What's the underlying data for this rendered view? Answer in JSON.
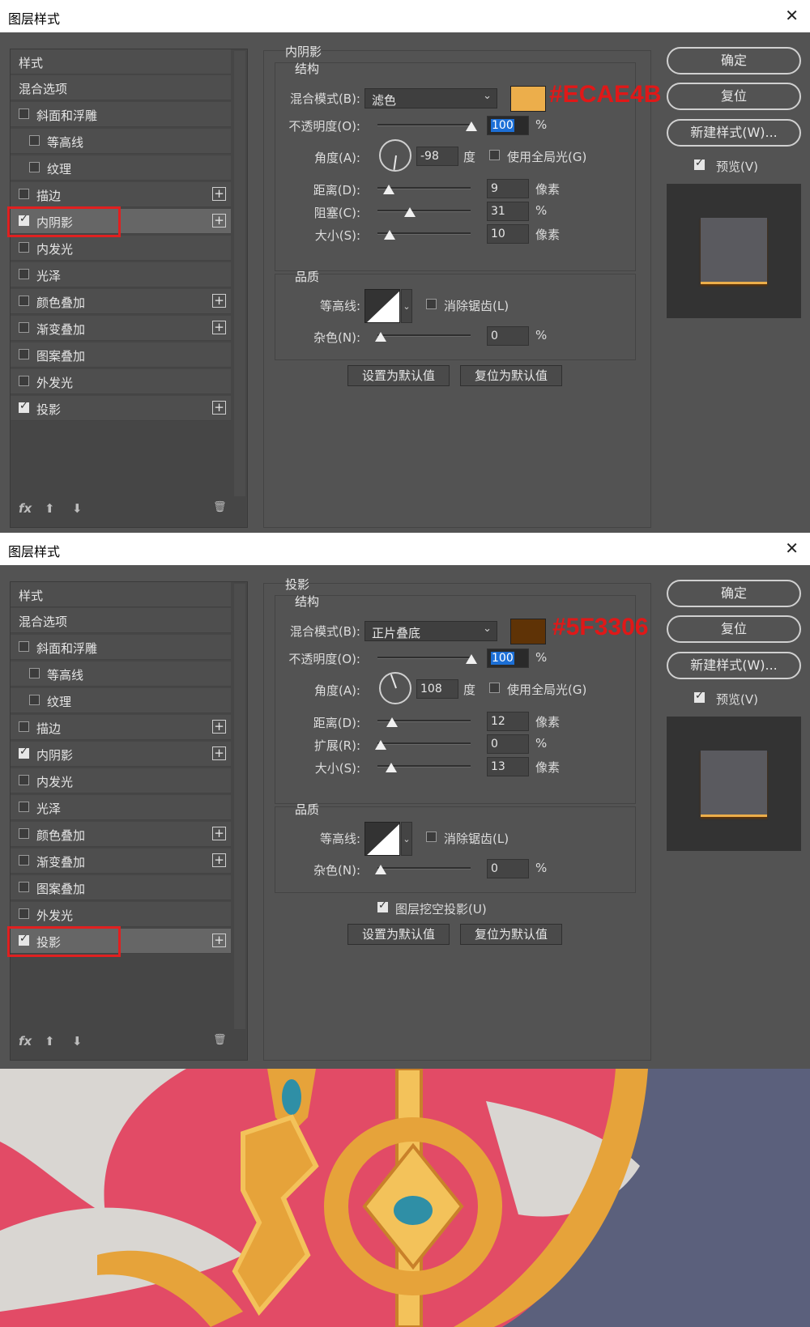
{
  "dialog1": {
    "title": "图层样式",
    "close": "✕",
    "sidebar": {
      "items": [
        {
          "label": "样式"
        },
        {
          "label": "混合选项"
        },
        {
          "label": "斜面和浮雕"
        },
        {
          "label": "等高线"
        },
        {
          "label": "纹理"
        },
        {
          "label": "描边"
        },
        {
          "label": "内阴影"
        },
        {
          "label": "内发光"
        },
        {
          "label": "光泽"
        },
        {
          "label": "颜色叠加"
        },
        {
          "label": "渐变叠加"
        },
        {
          "label": "图案叠加"
        },
        {
          "label": "外发光"
        },
        {
          "label": "投影"
        }
      ],
      "checked": [
        "内阴影",
        "投影"
      ],
      "selected": "内阴影",
      "footer": {
        "fx": "fx",
        "up": "⬆",
        "down": "⬇",
        "trash": "🗑"
      }
    },
    "panel": {
      "section": "内阴影",
      "structure": "结构",
      "blend_label": "混合模式(B):",
      "blend_value": "滤色",
      "color": "#ECAE4B",
      "hex_label": "#ECAE4B",
      "opacity_label": "不透明度(O):",
      "opacity": "100",
      "opacity_unit": "%",
      "angle_label": "角度(A):",
      "angle": "-98",
      "angle_unit": "度",
      "global_light": "使用全局光(G)",
      "distance_label": "距离(D):",
      "distance": "9",
      "distance_unit": "像素",
      "choke_label": "阻塞(C):",
      "choke": "31",
      "choke_unit": "%",
      "size_label": "大小(S):",
      "size": "10",
      "size_unit": "像素",
      "quality": "品质",
      "contour_label": "等高线:",
      "antialias": "消除锯齿(L)",
      "noise_label": "杂色(N):",
      "noise": "0",
      "noise_unit": "%",
      "make_default": "设置为默认值",
      "reset_default": "复位为默认值"
    },
    "buttons": {
      "ok": "确定",
      "reset": "复位",
      "new_style": "新建样式(W)...",
      "preview": "预览(V)"
    }
  },
  "dialog2": {
    "title": "图层样式",
    "close": "✕",
    "sidebar": {
      "items": [
        {
          "label": "样式"
        },
        {
          "label": "混合选项"
        },
        {
          "label": "斜面和浮雕"
        },
        {
          "label": "等高线"
        },
        {
          "label": "纹理"
        },
        {
          "label": "描边"
        },
        {
          "label": "内阴影"
        },
        {
          "label": "内发光"
        },
        {
          "label": "光泽"
        },
        {
          "label": "颜色叠加"
        },
        {
          "label": "渐变叠加"
        },
        {
          "label": "图案叠加"
        },
        {
          "label": "外发光"
        },
        {
          "label": "投影"
        }
      ],
      "checked": [
        "内阴影",
        "投影"
      ],
      "selected": "投影",
      "footer": {
        "fx": "fx",
        "up": "⬆",
        "down": "⬇",
        "trash": "🗑"
      }
    },
    "panel": {
      "section": "投影",
      "structure": "结构",
      "blend_label": "混合模式(B):",
      "blend_value": "正片叠底",
      "color": "#5F3306",
      "hex_label": "#5F3306",
      "opacity_label": "不透明度(O):",
      "opacity": "100",
      "opacity_unit": "%",
      "angle_label": "角度(A):",
      "angle": "108",
      "angle_unit": "度",
      "global_light": "使用全局光(G)",
      "distance_label": "距离(D):",
      "distance": "12",
      "distance_unit": "像素",
      "spread_label": "扩展(R):",
      "spread": "0",
      "spread_unit": "%",
      "size_label": "大小(S):",
      "size": "13",
      "size_unit": "像素",
      "quality": "品质",
      "contour_label": "等高线:",
      "antialias": "消除锯齿(L)",
      "noise_label": "杂色(N):",
      "noise": "0",
      "noise_unit": "%",
      "knockout": "图层挖空投影(U)",
      "make_default": "设置为默认值",
      "reset_default": "复位为默认值"
    },
    "buttons": {
      "ok": "确定",
      "reset": "复位",
      "new_style": "新建样式(W)...",
      "preview": "预览(V)"
    }
  },
  "artwork": {
    "palette": [
      "#5b607c",
      "#e24b66",
      "#d9d6d2",
      "#e6a33a",
      "#f3c25a",
      "#2f8fa6"
    ]
  }
}
